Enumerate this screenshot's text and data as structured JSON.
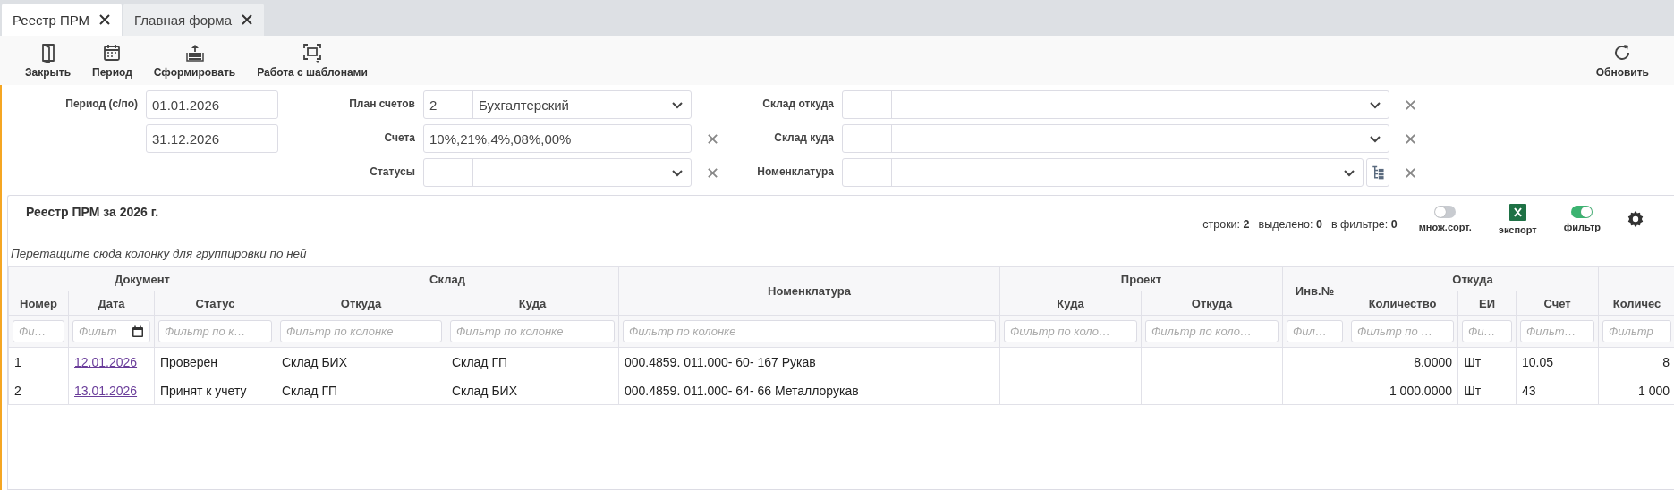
{
  "tabs": [
    {
      "label": "Реестр ПРМ",
      "selected": true
    },
    {
      "label": "Главная форма",
      "selected": false
    }
  ],
  "toolbar": {
    "left": [
      {
        "label": "Закрыть"
      },
      {
        "label": "Период"
      },
      {
        "label": "Сформировать"
      },
      {
        "label": "Работа с шаблонами"
      }
    ],
    "right": [
      {
        "label": "Обновить"
      }
    ]
  },
  "filter_columns": [
    [
      {
        "label": "Период (с/по)",
        "kind": "text",
        "value": "01.01.2026"
      },
      {
        "kind": "text",
        "value": "31.12.2026"
      }
    ],
    [
      {
        "label": "План счетов",
        "kind": "combo",
        "code": "2",
        "value": "Бухгалтерский",
        "clearable": false
      },
      {
        "label": "Счета",
        "kind": "text",
        "value": "10%,21%,4%,08%,00%",
        "clearable": true
      },
      {
        "label": "Статусы",
        "kind": "combo",
        "clearable": true
      }
    ],
    [
      {
        "label": "Склад откуда",
        "kind": "combo",
        "clearable": true
      },
      {
        "label": "Склад куда",
        "kind": "combo",
        "clearable": true
      },
      {
        "label": "Номенклатура",
        "kind": "combo",
        "clearable": true,
        "tree_button": true
      }
    ]
  ],
  "grid": {
    "title": "Реестр ПРМ за 2026 г.",
    "stats": [
      {
        "label": "строки:",
        "value": "2"
      },
      {
        "label": "выделено:",
        "value": "0"
      },
      {
        "label": "в фильтре:",
        "value": "0"
      }
    ],
    "controls": [
      {
        "label": "множ.сорт.",
        "kind": "toggle",
        "on": false
      },
      {
        "label": "экспорт",
        "kind": "excel"
      },
      {
        "label": "фильтр",
        "kind": "toggle",
        "on": true
      }
    ],
    "group_hint": "Перетащите сюда колонку для группировки по ней",
    "header_groups": [
      {
        "label": "Документ",
        "kind": "group",
        "columns": [
          {
            "label": "Номер",
            "filter": "Фи…"
          },
          {
            "label": "Дата",
            "filter": "Фильт",
            "kind": "date"
          },
          {
            "label": "Статус",
            "filter": "Фильтр по к…"
          }
        ]
      },
      {
        "label": "Склад",
        "kind": "group",
        "columns": [
          {
            "label": "Откуда",
            "filter": "Фильтр по колонке"
          },
          {
            "label": "Куда",
            "filter": "Фильтр по колонке"
          }
        ]
      },
      {
        "kind": "tall",
        "columns": [
          {
            "label": "Номенклатура",
            "filter": "Фильтр по колонке"
          }
        ]
      },
      {
        "label": "Проект",
        "kind": "group",
        "columns": [
          {
            "label": "Куда",
            "filter": "Фильтр по коло…"
          },
          {
            "label": "Откуда",
            "filter": "Фильтр по коло…"
          }
        ]
      },
      {
        "kind": "tall",
        "columns": [
          {
            "label": "Инв.№",
            "filter": "Фил…"
          }
        ]
      },
      {
        "label": "Откуда",
        "kind": "group",
        "columns": [
          {
            "label": "Количество",
            "filter": "Фильтр по …",
            "kind": "number"
          },
          {
            "label": "ЕИ",
            "filter": "Фи…"
          },
          {
            "label": "Счет",
            "filter": "Фильт…"
          }
        ]
      },
      {
        "kind": "group",
        "columns": [
          {
            "label": "Количес",
            "filter": "Фильтр",
            "kind": "number"
          }
        ]
      }
    ],
    "rows": [
      {
        "cells": [
          "1",
          "12.01.2026",
          "Проверен",
          "Склад БИХ",
          "Склад ГП",
          "000.4859. 011.000- 60- 167 Рукав",
          null,
          null,
          null,
          "8.0000",
          "Шт",
          "10.05",
          "8"
        ]
      },
      {
        "cells": [
          "2",
          "13.01.2026",
          "Принят к учету",
          "Склад ГП",
          "Склад БИХ",
          "000.4859. 011.000- 64- 66 Металлорукав",
          null,
          null,
          null,
          "1 000.0000",
          "Шт",
          "43",
          "1 000"
        ]
      }
    ]
  }
}
